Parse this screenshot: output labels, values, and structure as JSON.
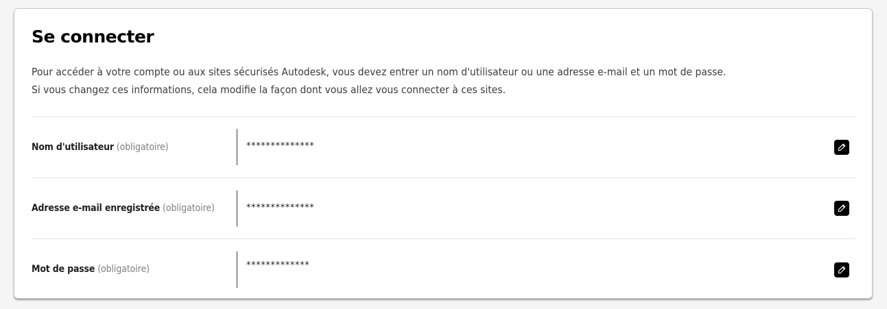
{
  "section": {
    "title": "Se connecter",
    "description_line1": "Pour accéder à votre compte ou aux sites sécurisés Autodesk, vous devez entrer un nom d'utilisateur ou une adresse e-mail et un mot de passe.",
    "description_line2": "Si vous changez ces informations, cela modifie la façon dont vous allez vous connecter à ces sites."
  },
  "fields": [
    {
      "label": "Nom d'utilisateur",
      "required": "(obligatoire)",
      "value": "**************",
      "edit_icon": "pencil-icon"
    },
    {
      "label": "Adresse e-mail enregistrée",
      "required": "(obligatoire)",
      "value": "**************",
      "edit_icon": "pencil-icon"
    },
    {
      "label": "Mot de passe",
      "required": "(obligatoire)",
      "value": "*************",
      "edit_icon": "pencil-icon"
    }
  ],
  "colors": {
    "edit_button_bg": "#000000",
    "required_text": "#808080",
    "divider": "#e4e4e4"
  }
}
